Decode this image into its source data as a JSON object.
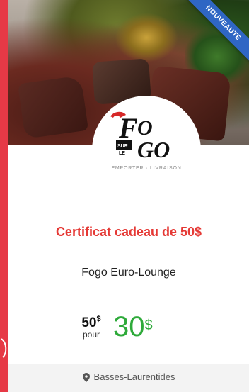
{
  "badge": {
    "label": "NOUVEAUTÉ"
  },
  "logo": {
    "subtitle": "EMPORTER · LIVRAISON"
  },
  "offer": {
    "title": "Certificat cadeau de 50$",
    "merchant": "Fogo Euro-Lounge",
    "original_amount": "50",
    "original_currency": "$",
    "pour": "pour",
    "new_amount": "30",
    "new_currency": "$"
  },
  "location": {
    "label": "Basses-Laurentides",
    "icon": "map-pin-icon"
  },
  "colors": {
    "background": "#e63946",
    "title": "#e53935",
    "price": "#2eaa3a",
    "ribbon": "#2f66c4"
  }
}
